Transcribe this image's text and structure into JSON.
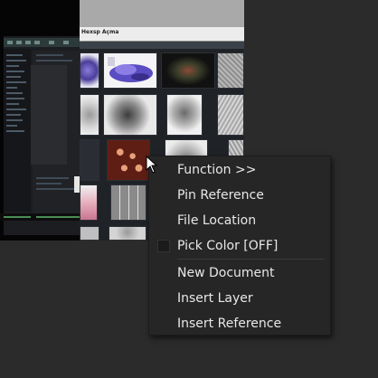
{
  "grid_window": {
    "title": "Hexsp Açma"
  },
  "context_menu": {
    "items": [
      {
        "label": "Function >>"
      },
      {
        "label": "Pin Reference"
      },
      {
        "label": "File Location"
      },
      {
        "label": "Pick Color [OFF]",
        "checked": false
      },
      {
        "label": "New Document"
      },
      {
        "label": "Insert Layer"
      },
      {
        "label": "Insert Reference"
      }
    ]
  },
  "colors": {
    "canvas_background": "#2b2b2b",
    "menu_background": "#262626",
    "menu_text": "#e8e8e8",
    "menu_separator": "#3a3a3a"
  },
  "icons": {
    "cursor": "mouse-pointer-icon",
    "checkbox": "checkbox-unchecked-icon"
  }
}
